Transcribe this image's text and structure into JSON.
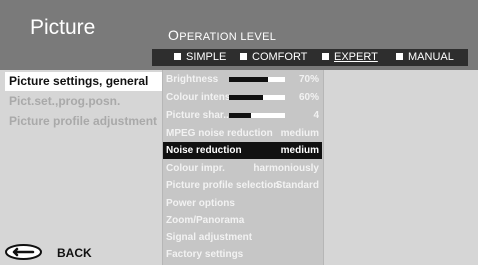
{
  "title": "Picture",
  "operation_level": {
    "label_first": "O",
    "label_rest": "PERATION LEVEL",
    "options": [
      {
        "label": "SIMPLE",
        "active": false
      },
      {
        "label": "COMFORT",
        "active": false
      },
      {
        "label": "EXPERT",
        "active": true
      },
      {
        "label": "MANUAL",
        "active": false
      }
    ]
  },
  "left_menu": {
    "items": [
      {
        "label": "Picture settings, general",
        "selected": true
      },
      {
        "label": "Pict.set.,prog.posn.",
        "selected": false
      },
      {
        "label": "Picture profile adjustment",
        "selected": false
      }
    ],
    "back_label": "BACK",
    "back_icon": "back-arrow-icon"
  },
  "settings": [
    {
      "label": "Brightness",
      "value": "70%",
      "slider": 0.7
    },
    {
      "label": "Colour intens.",
      "value": "60%",
      "slider": 0.6
    },
    {
      "label": "Picture shar...",
      "value": "4",
      "slider": 0.4
    },
    {
      "label": "MPEG noise reduction",
      "value": "medium"
    },
    {
      "label": "Noise reduction",
      "value": "medium",
      "selected": true
    },
    {
      "label": "Colour impr.",
      "value": "harmoniously"
    },
    {
      "label": "Picture profile selection",
      "value": "Standard"
    },
    {
      "label": "Power options",
      "value": ""
    },
    {
      "label": "Zoom/Panorama",
      "value": ""
    },
    {
      "label": "Signal adjustment",
      "value": ""
    },
    {
      "label": "Factory settings",
      "value": ""
    }
  ],
  "colors": {
    "header": "#7a7a7a",
    "selected_row": "#111111",
    "panel": "#c6c6c6"
  }
}
